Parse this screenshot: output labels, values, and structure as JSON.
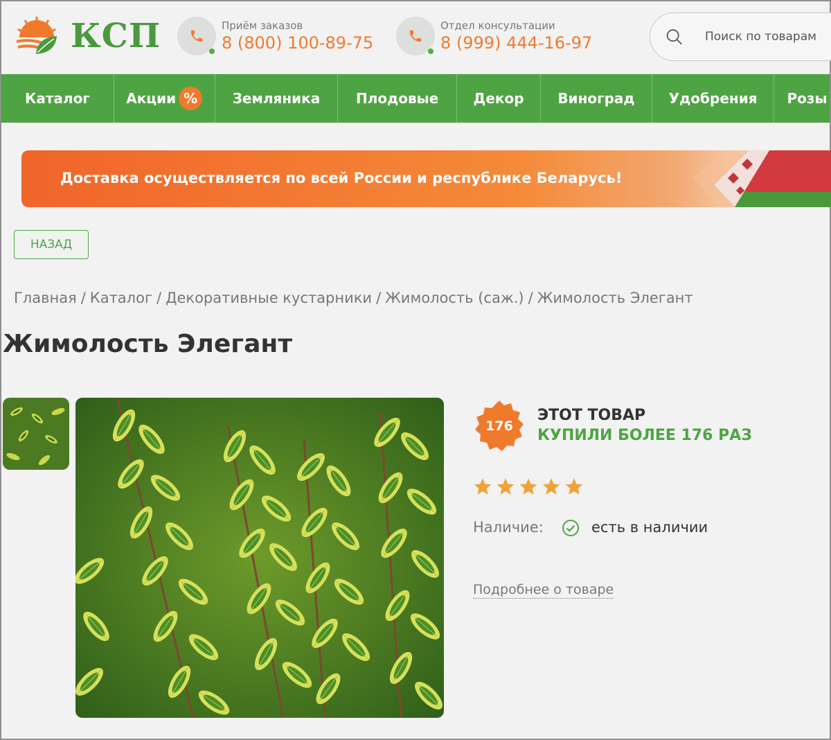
{
  "header": {
    "logo_text": "КСП",
    "contacts": [
      {
        "label": "Приём заказов",
        "phone": "8 (800) 100-89-75"
      },
      {
        "label": "Отдел консультации",
        "phone": "8 (999) 444-16-97"
      }
    ],
    "search": {
      "placeholder": "Поиск по товарам"
    }
  },
  "nav": {
    "items": [
      {
        "label": "Каталог"
      },
      {
        "label": "Акции",
        "badge": "%"
      },
      {
        "label": "Земляника"
      },
      {
        "label": "Плодовые"
      },
      {
        "label": "Декор"
      },
      {
        "label": "Виноград"
      },
      {
        "label": "Удобрения"
      },
      {
        "label": "Розы"
      }
    ]
  },
  "banner": {
    "text": "Доставка осуществляется по всей России и республике Беларусь!"
  },
  "back_button": "НАЗАД",
  "breadcrumb": [
    "Главная",
    "Каталог",
    "Декоративные кустарники",
    "Жимолость (саж.)",
    "Жимолость Элегант"
  ],
  "breadcrumb_separator": "/",
  "product": {
    "title": "Жимолость Элегант",
    "sold_count": "176",
    "sold_line1": "ЭТОТ ТОВАР",
    "sold_line2": "КУПИЛИ БОЛЕЕ 176 РАЗ",
    "rating": 5,
    "rating_max": 5,
    "availability_label": "Наличие:",
    "availability_value": "есть в наличии",
    "more_link": "Подробнее о товаре"
  },
  "colors": {
    "brand_green": "#4ea443",
    "accent_orange": "#f07a2c",
    "star_color": "#f0a33a"
  },
  "icons": {
    "logo": "leaf-sun-logo",
    "contact": "phone-icon",
    "search": "search-icon",
    "availability": "check-circle-icon",
    "rating": "star-icon"
  }
}
